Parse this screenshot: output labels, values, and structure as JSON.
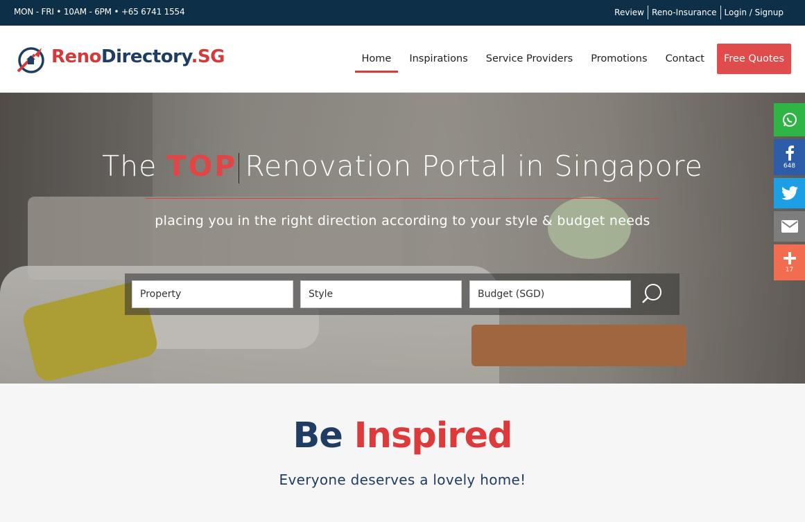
{
  "topbar": {
    "hours": "MON - FRI • 10AM - 6PM • +65 6741 1554",
    "links": [
      "Review",
      "Reno-Insurance",
      "Login / Signup"
    ]
  },
  "brand": {
    "reno": "Reno",
    "directory": "Directory",
    "sg": ".SG"
  },
  "nav": {
    "items": [
      "Home",
      "Inspirations",
      "Service Providers",
      "Promotions",
      "Contact"
    ],
    "cta": "Free Quotes",
    "active": "Home"
  },
  "hero": {
    "title_pre": "The",
    "title_highlight": "TOP",
    "title_post": "Renovation Portal in Singapore",
    "subtitle": "placing you in the right direction according to your style & budget needs",
    "search": {
      "property": "Property",
      "style": "Style",
      "budget": "Budget (SGD)"
    }
  },
  "social": {
    "facebook_count": "648",
    "share_count": "17"
  },
  "section": {
    "be": "Be",
    "inspired": "Inspired",
    "tagline": "Everyone deserves a lovely home!"
  },
  "colors": {
    "navy": "#0d2f47",
    "accent": "#e04b4b",
    "brand_blue": "#1f3d63"
  }
}
